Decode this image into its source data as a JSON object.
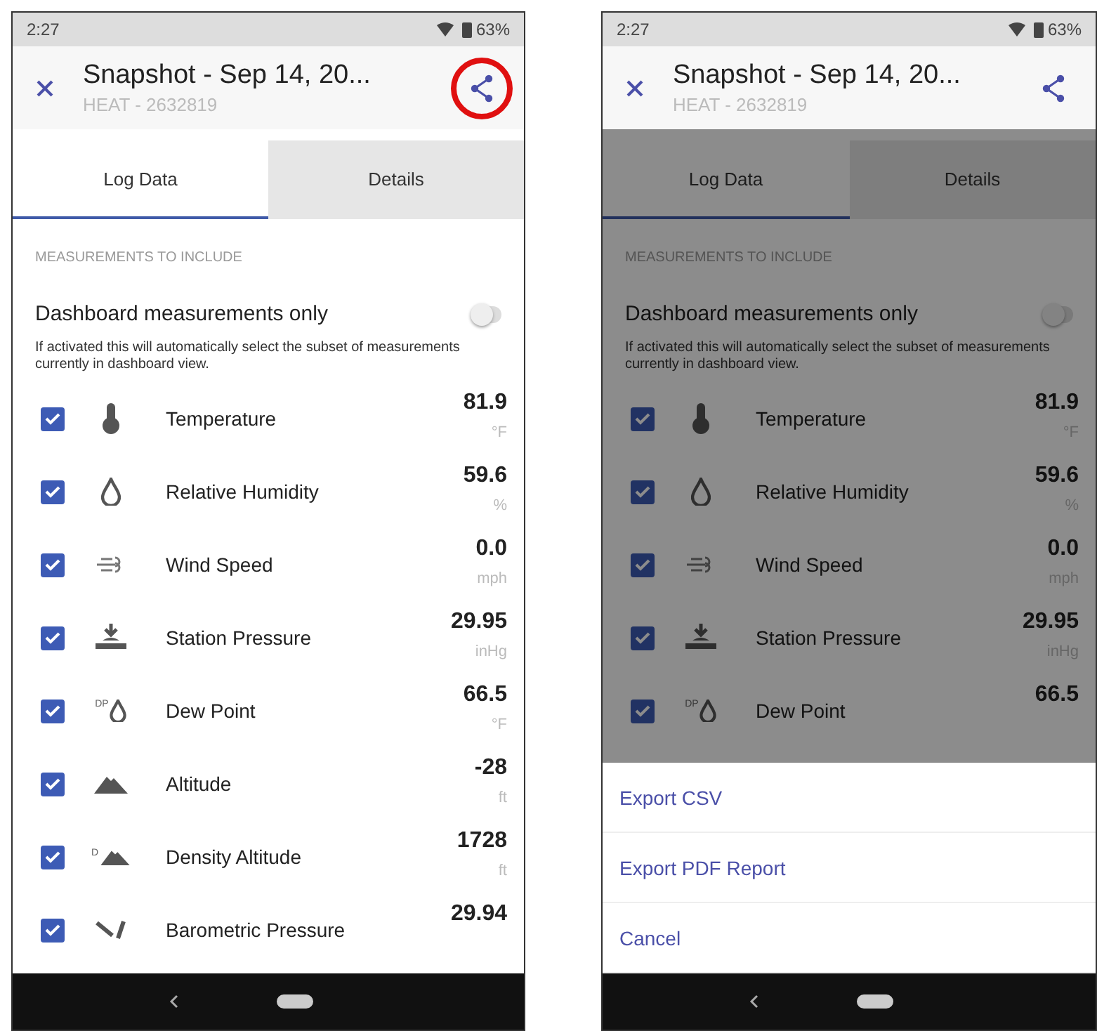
{
  "screens": [
    {
      "status_bar": {
        "time": "2:27",
        "battery": "63%"
      },
      "header": {
        "title": "Snapshot - Sep 14, 20...",
        "subtitle": "HEAT - 2632819",
        "share_circled": true
      },
      "tabs": [
        {
          "label": "Log Data",
          "selected": true
        },
        {
          "label": "Details",
          "selected": false
        }
      ],
      "section_label": "MEASUREMENTS TO INCLUDE",
      "toggle": {
        "label": "Dashboard measurements only",
        "on": false,
        "hint": "If activated this will automatically select the subset of measurements currently in dashboard view."
      },
      "dimmed": false,
      "rows": [
        {
          "kind": "thermometer",
          "name": "Temperature",
          "value": "81.9",
          "unit": "°F",
          "checked": true
        },
        {
          "kind": "drop",
          "name": "Relative Humidity",
          "value": "59.6",
          "unit": "%",
          "checked": true
        },
        {
          "kind": "wind",
          "name": "Wind Speed",
          "value": "0.0",
          "unit": "mph",
          "checked": true
        },
        {
          "kind": "pressure",
          "name": "Station Pressure",
          "value": "29.95",
          "unit": "inHg",
          "checked": true
        },
        {
          "kind": "dew_point",
          "icon_text": "DP",
          "name": "Dew Point",
          "value": "66.5",
          "unit": "°F",
          "checked": true
        },
        {
          "kind": "mountain",
          "name": "Altitude",
          "value": "-28",
          "unit": "ft",
          "checked": true
        },
        {
          "kind": "density_mountain",
          "icon_text": "D",
          "name": "Density Altitude",
          "value": "1728",
          "unit": "ft",
          "checked": true
        },
        {
          "kind": "barometer",
          "name": "Barometric Pressure",
          "value": "29.94",
          "checked": true
        }
      ]
    },
    {
      "status_bar": {
        "time": "2:27",
        "battery": "63%"
      },
      "header": {
        "title": "Snapshot - Sep 14, 20...",
        "subtitle": "HEAT - 2632819"
      },
      "tabs": [
        {
          "label": "Log Data",
          "selected": true
        },
        {
          "label": "Details",
          "selected": false
        }
      ],
      "section_label": "MEASUREMENTS TO INCLUDE",
      "toggle": {
        "label": "Dashboard measurements only",
        "on": false,
        "hint": "If activated this will automatically select the subset of measurements currently in dashboard view."
      },
      "dimmed": true,
      "rows": [
        {
          "kind": "thermometer",
          "name": "Temperature",
          "value": "81.9",
          "unit": "°F",
          "checked": true
        },
        {
          "kind": "drop",
          "name": "Relative Humidity",
          "value": "59.6",
          "unit": "%",
          "checked": true
        },
        {
          "kind": "wind",
          "name": "Wind Speed",
          "value": "0.0",
          "unit": "mph",
          "checked": true
        },
        {
          "kind": "pressure",
          "name": "Station Pressure",
          "value": "29.95",
          "unit": "inHg",
          "checked": true
        },
        {
          "kind": "dew_point",
          "icon_text": "DP",
          "name": "Dew Point",
          "value": "66.5",
          "checked": true
        }
      ],
      "sheet": [
        {
          "label": "Export CSV"
        },
        {
          "label": "Export PDF Report"
        },
        {
          "label": "Cancel"
        }
      ]
    }
  ]
}
